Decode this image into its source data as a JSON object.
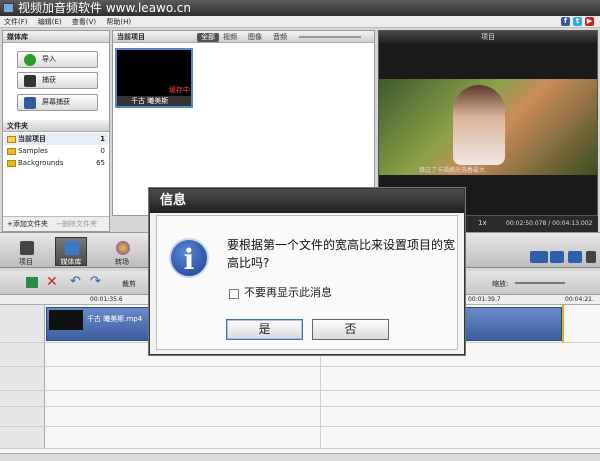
{
  "app": {
    "title": "视频加音频软件 www.leawo.cn",
    "menu": [
      "文件(F)",
      "编辑(E)",
      "查看(V)",
      "帮助(H)"
    ],
    "social": [
      {
        "label": "f",
        "color": "#3b5998"
      },
      {
        "label": "t",
        "color": "#33aadd"
      },
      {
        "label": "▶",
        "color": "#cc2222"
      }
    ]
  },
  "library": {
    "header": "媒体库",
    "buttons": [
      {
        "label": "导入",
        "icon": "plus-icon"
      },
      {
        "label": "捕获",
        "icon": "camera-icon"
      },
      {
        "label": "屏幕捕获",
        "icon": "screen-capture-icon"
      }
    ],
    "folders_header": "文件夹",
    "folders": [
      {
        "name": "当前项目",
        "count": "1"
      },
      {
        "name": "Samples",
        "count": "0"
      },
      {
        "name": "Backgrounds",
        "count": "65"
      }
    ],
    "add_folder": "添加文件夹",
    "delete_folder": "删除文件夹"
  },
  "current_project": {
    "header": "当前项目",
    "filters": [
      "全部",
      "视频",
      "图像",
      "音频"
    ],
    "item": {
      "name": "千古 曦美斯",
      "status": "缓存中"
    }
  },
  "preview": {
    "header": "项目",
    "caption": "错过了卡福摘光浩春最大",
    "speed": "1x",
    "time": "00:02:50.078 / 00:04:13.002"
  },
  "toolbar": {
    "buttons": [
      "项目",
      "媒体库",
      "转场"
    ]
  },
  "editbar": {
    "clip_label": "裁剪",
    "zoom_label": "缩放:"
  },
  "ruler": {
    "ticks": [
      "00:01:35.6",
      "00:01:39.7",
      "00:04:21."
    ]
  },
  "timeline": {
    "clip_name": "千古 曦美斯.mp4"
  },
  "dialog": {
    "title": "信息",
    "message": "要根据第一个文件的宽高比来设置项目的宽高比吗?",
    "checkbox_label": "不要再显示此消息",
    "checked": false,
    "yes": "是",
    "no": "否"
  }
}
